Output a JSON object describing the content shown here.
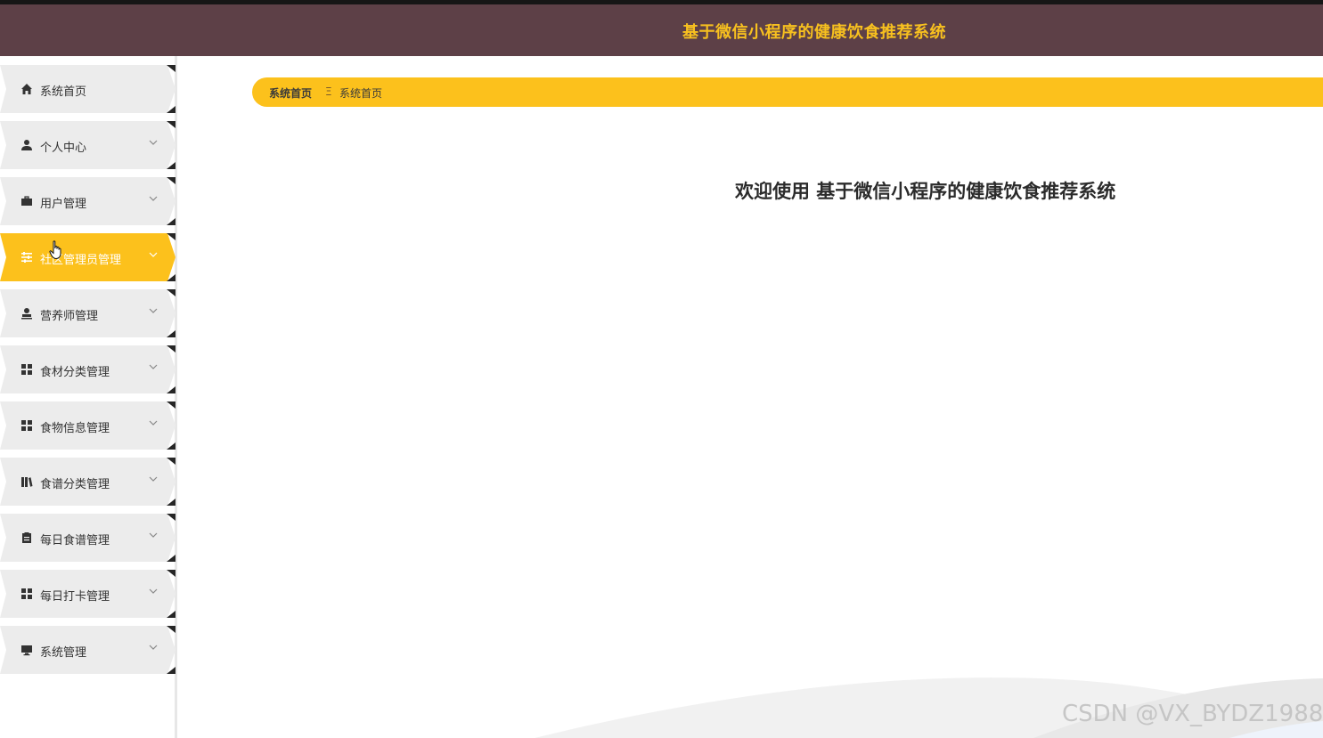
{
  "header": {
    "title": "基于微信小程序的健康饮食推荐系统"
  },
  "sidebar": {
    "items": [
      {
        "label": "系统首页",
        "icon": "home-icon",
        "expandable": false,
        "active": false
      },
      {
        "label": "个人中心",
        "icon": "user-icon",
        "expandable": true,
        "active": false
      },
      {
        "label": "用户管理",
        "icon": "briefcase-icon",
        "expandable": true,
        "active": false
      },
      {
        "label": "社区管理员管理",
        "icon": "sliders-icon",
        "expandable": true,
        "active": true
      },
      {
        "label": "营养师管理",
        "icon": "person-badge-icon",
        "expandable": true,
        "active": false
      },
      {
        "label": "食材分类管理",
        "icon": "grid-icon",
        "expandable": true,
        "active": false
      },
      {
        "label": "食物信息管理",
        "icon": "grid-icon",
        "expandable": true,
        "active": false
      },
      {
        "label": "食谱分类管理",
        "icon": "book-icon",
        "expandable": true,
        "active": false
      },
      {
        "label": "每日食谱管理",
        "icon": "clipboard-icon",
        "expandable": true,
        "active": false
      },
      {
        "label": "每日打卡管理",
        "icon": "grid-icon",
        "expandable": true,
        "active": false
      },
      {
        "label": "系统管理",
        "icon": "monitor-icon",
        "expandable": true,
        "active": false
      }
    ]
  },
  "breadcrumb": {
    "home": "系统首页",
    "separator": "Ξ",
    "current": "系统首页"
  },
  "main": {
    "welcome": "欢迎使用 基于微信小程序的健康饮食推荐系统"
  },
  "watermark": "CSDN @VX_BYDZ1988",
  "colors": {
    "header_bg": "#5d4047",
    "accent": "#fcc11c",
    "title": "#f7c01f",
    "menu_bg": "#ececec"
  }
}
